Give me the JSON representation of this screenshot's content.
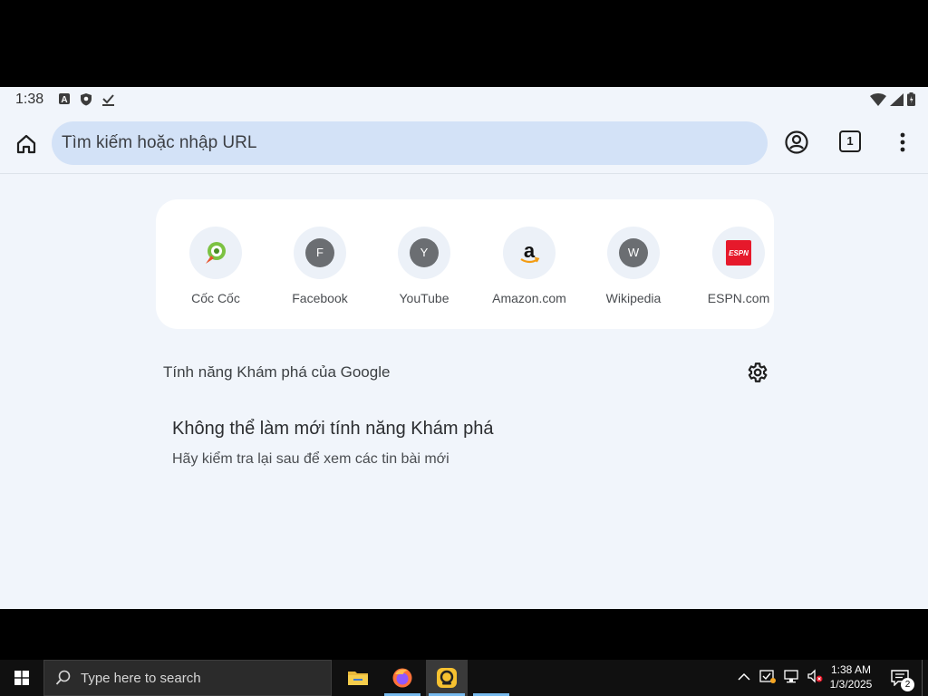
{
  "status_bar": {
    "time": "1:38",
    "left_icons": [
      "a-icon",
      "shield-icon",
      "download-check-icon"
    ],
    "right_icons": [
      "wifi-icon",
      "cell-signal-icon",
      "battery-icon"
    ]
  },
  "toolbar": {
    "omnibox_placeholder": "Tìm kiếm hoặc nhập URL",
    "tab_count": "1"
  },
  "shortcuts": [
    {
      "label": "Cốc Cốc",
      "icon": "coccoc-logo-icon",
      "letter": ""
    },
    {
      "label": "Facebook",
      "icon": "letter-icon",
      "letter": "F"
    },
    {
      "label": "YouTube",
      "icon": "letter-icon",
      "letter": "Y"
    },
    {
      "label": "Amazon.com",
      "icon": "amazon-logo-icon",
      "letter": "a"
    },
    {
      "label": "Wikipedia",
      "icon": "letter-icon",
      "letter": "W"
    },
    {
      "label": "ESPN.com",
      "icon": "espn-logo-icon",
      "letter": "ESPN"
    }
  ],
  "discover": {
    "header": "Tính năng Khám phá của Google",
    "error_title": "Không thể làm mới tính năng Khám phá",
    "error_subtitle": "Hãy kiểm tra lại sau để xem các tin bài mới"
  },
  "taskbar": {
    "search_placeholder": "Type here to search",
    "clock_time": "1:38 AM",
    "clock_date": "1/3/2025",
    "notification_count": "2",
    "apps": [
      "file-explorer-icon",
      "firefox-icon",
      "emulator-icon",
      "blank-app"
    ]
  },
  "colors": {
    "screen_bg": "#f1f5fb",
    "omnibox_bg": "#d3e2f7",
    "taskbar_bg": "#101010",
    "accent": "#76b9ed"
  }
}
